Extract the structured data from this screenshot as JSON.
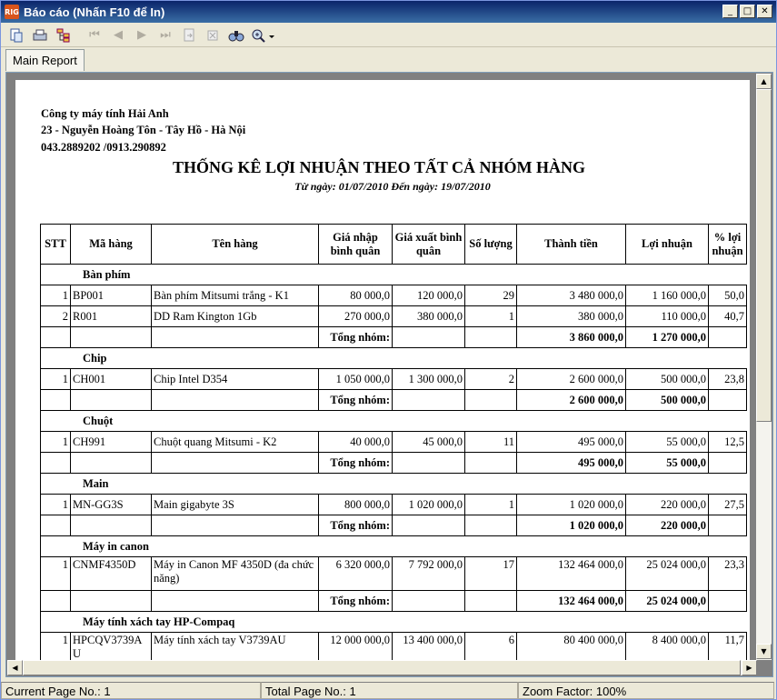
{
  "window": {
    "title": "Báo cáo (Nhấn F10 để In)",
    "icon_text": "RIG",
    "min_glyph": "_",
    "max_glyph": "□",
    "close_glyph": "✕"
  },
  "tabs": [
    "Main Report"
  ],
  "report": {
    "company_name": "Công ty máy tính Hải Anh",
    "company_address": "23 - Nguyễn Hoàng Tôn - Tây Hồ - Hà Nội",
    "company_phone": "043.2889202 /0913.290892",
    "title": "THỐNG KÊ LỢI NHUẬN THEO TẤT CẢ NHÓM HÀNG",
    "date_range": "Từ ngày: 01/07/2010 Đến ngày: 19/07/2010",
    "columns": {
      "stt": "STT",
      "code": "Mã hàng",
      "name": "Tên hàng",
      "buy": "Giá nhập bình quân",
      "sell": "Giá xuất bình quân",
      "qty": "Số lượng",
      "amount": "Thành tiền",
      "profit": "Lợi nhuận",
      "pct": "% lợi nhuận"
    },
    "group_total_label": "Tổng nhóm:",
    "groups": [
      {
        "name": "Bàn phím",
        "rows": [
          {
            "stt": "1",
            "code": "BP001",
            "name": "Bàn phím Mitsumi trắng - K1",
            "buy": "80 000,0",
            "sell": "120 000,0",
            "qty": "29",
            "amount": "3 480 000,0",
            "profit": "1 160 000,0",
            "pct": "50,0"
          },
          {
            "stt": "2",
            "code": "R001",
            "name": "DD Ram Kington 1Gb",
            "buy": "270 000,0",
            "sell": "380 000,0",
            "qty": "1",
            "amount": "380 000,0",
            "profit": "110 000,0",
            "pct": "40,7"
          }
        ],
        "total_amount": "3 860 000,0",
        "total_profit": "1 270 000,0"
      },
      {
        "name": "Chip",
        "rows": [
          {
            "stt": "1",
            "code": "CH001",
            "name": "Chip Intel D354",
            "buy": "1 050 000,0",
            "sell": "1 300 000,0",
            "qty": "2",
            "amount": "2 600 000,0",
            "profit": "500 000,0",
            "pct": "23,8"
          }
        ],
        "total_amount": "2 600 000,0",
        "total_profit": "500 000,0"
      },
      {
        "name": "Chuột",
        "rows": [
          {
            "stt": "1",
            "code": "CH991",
            "name": "Chuột quang Mitsumi - K2",
            "buy": "40 000,0",
            "sell": "45 000,0",
            "qty": "11",
            "amount": "495 000,0",
            "profit": "55 000,0",
            "pct": "12,5"
          }
        ],
        "total_amount": "495 000,0",
        "total_profit": "55 000,0"
      },
      {
        "name": "Main",
        "rows": [
          {
            "stt": "1",
            "code": "MN-GG3S",
            "name": "Main gigabyte 3S",
            "buy": "800 000,0",
            "sell": "1 020 000,0",
            "qty": "1",
            "amount": "1 020 000,0",
            "profit": "220 000,0",
            "pct": "27,5"
          }
        ],
        "total_amount": "1 020 000,0",
        "total_profit": "220 000,0"
      },
      {
        "name": "Máy in canon",
        "rows": [
          {
            "stt": "1",
            "code": "CNMF4350D",
            "name": "Máy in Canon MF 4350D (đa chức năng)",
            "buy": "6 320 000,0",
            "sell": "7 792 000,0",
            "qty": "17",
            "amount": "132 464 000,0",
            "profit": "25 024 000,0",
            "pct": "23,3"
          }
        ],
        "total_amount": "132 464 000,0",
        "total_profit": "25 024 000,0"
      },
      {
        "name": "Máy tính xách tay HP-Compaq",
        "rows": [
          {
            "stt": "1",
            "code": "HPCQV3739AU",
            "name": "Máy tính xách tay V3739AU",
            "buy": "12 000 000,0",
            "sell": "13 400 000,0",
            "qty": "6",
            "amount": "80 400 000,0",
            "profit": "8 400 000,0",
            "pct": "11,7"
          }
        ]
      }
    ]
  },
  "status": {
    "current_page": "Current Page No.: 1",
    "total_page": "Total Page No.: 1",
    "zoom": "Zoom Factor: 100%"
  }
}
